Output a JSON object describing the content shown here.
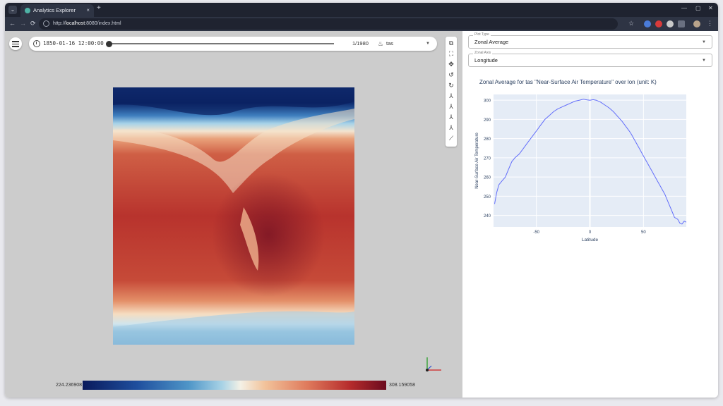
{
  "browser": {
    "tab_title": "Analytics Explorer",
    "url_host": "localhost",
    "url_rest": ":8080/index.html",
    "new_tab": "+",
    "tab_close": "×",
    "nav_back": "←",
    "nav_forward": "→",
    "nav_reload": "⟳",
    "win_min": "—",
    "win_max": "▢",
    "win_close": "✕",
    "star": "☆",
    "kebab": "⋮"
  },
  "viewer": {
    "timestamp": "1850-01-16 12:00:00",
    "frame": "1/1980",
    "field": "tas",
    "timestep_fraction": 0.0,
    "colorbar_min": "224.236908",
    "colorbar_max": "308.159058",
    "tools": [
      "crop-icon",
      "fullscreen-icon",
      "move-icon",
      "rotate-left-icon",
      "rotate-right-icon",
      "axis-x-icon",
      "axis-y-icon",
      "axis-z-icon",
      "axis-reset-icon",
      "line-chart-icon"
    ],
    "colors": {
      "cold": "#0a1a5c",
      "mid": "#f4f1e6",
      "hot": "#6b0a1e"
    }
  },
  "panel": {
    "plot_type_label": "Plot Type",
    "plot_type_value": "Zonal Average",
    "zonal_axis_label": "Zonal Axis",
    "zonal_axis_value": "Longitude"
  },
  "chart_data": {
    "type": "line",
    "title": "Zonal Average for tas \"Near-Surface Air Temperature\" over lon (unit: K)",
    "xlabel": "Latitude",
    "ylabel": "Near-Surface Air Temperature",
    "xlim": [
      -90,
      90
    ],
    "ylim": [
      234,
      303
    ],
    "xticks": [
      "-50",
      "0",
      "50"
    ],
    "yticks": [
      "240",
      "250",
      "260",
      "270",
      "280",
      "290",
      "300"
    ],
    "grid": true,
    "series": [
      {
        "color": "#636efa",
        "x": [
          -89,
          -87,
          -85,
          -82,
          -79,
          -76,
          -73,
          -70,
          -66,
          -62,
          -58,
          -54,
          -50,
          -46,
          -42,
          -38,
          -34,
          -30,
          -26,
          -22,
          -18,
          -14,
          -10,
          -6,
          -3,
          0,
          3,
          6,
          10,
          14,
          18,
          22,
          26,
          30,
          34,
          38,
          42,
          46,
          50,
          54,
          58,
          62,
          66,
          70,
          73,
          76,
          79,
          82,
          84,
          86,
          88,
          90
        ],
        "y": [
          246,
          252,
          256,
          258,
          260,
          264,
          268,
          270,
          272,
          275,
          278,
          281,
          284,
          287,
          290,
          292,
          294,
          295.5,
          296.5,
          297.5,
          298.5,
          299.5,
          300,
          300.5,
          300.2,
          300,
          300.3,
          300,
          299,
          297.5,
          296,
          294,
          291.5,
          289,
          286,
          283,
          279,
          275,
          271,
          267,
          263,
          259,
          255,
          251,
          247,
          243,
          239,
          238,
          236,
          235.5,
          237,
          236.5
        ]
      }
    ]
  }
}
